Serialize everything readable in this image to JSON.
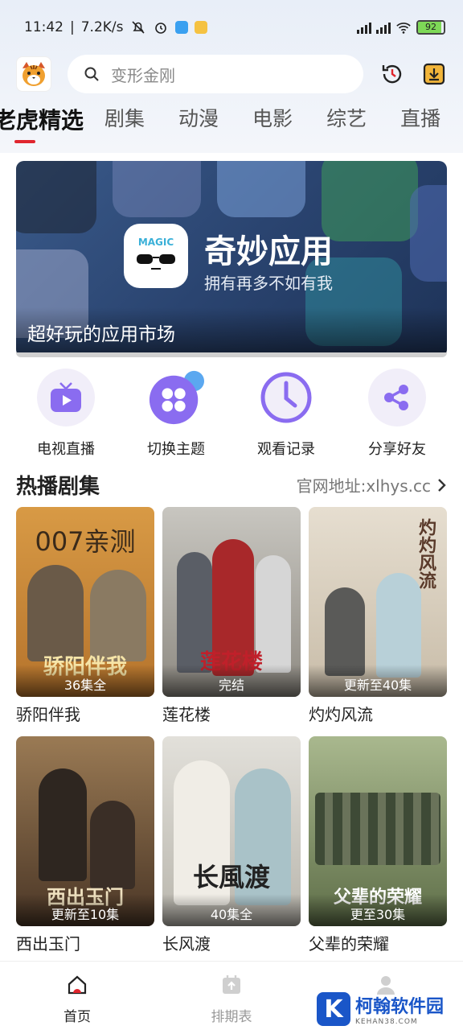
{
  "status_bar": {
    "time": "11:42",
    "speed": "7.2K/s",
    "battery": "92",
    "battery_level": 0.92
  },
  "header": {
    "search_placeholder": "变形金刚"
  },
  "tabs": [
    {
      "label": "老虎精选",
      "active": true
    },
    {
      "label": "剧集"
    },
    {
      "label": "动漫"
    },
    {
      "label": "电影"
    },
    {
      "label": "综艺"
    },
    {
      "label": "直播"
    }
  ],
  "banner": {
    "icon_text": "MAGIC",
    "title": "奇妙应用",
    "subtitle": "拥有再多不如有我",
    "caption": "超好玩的应用市场"
  },
  "quick_actions": [
    {
      "label": "电视直播",
      "icon": "tv-icon"
    },
    {
      "label": "切换主题",
      "icon": "theme-icon"
    },
    {
      "label": "观看记录",
      "icon": "clock-icon"
    },
    {
      "label": "分享好友",
      "icon": "share-icon"
    }
  ],
  "section": {
    "title": "热播剧集",
    "more": "官网地址:xlhys.cc"
  },
  "shows": [
    {
      "title": "骄阳伴我",
      "badge": "36集全",
      "poster_text": "007亲测",
      "poster_title": "骄阳伴我",
      "bg": "#c98a3a"
    },
    {
      "title": "莲花楼",
      "badge": "完结",
      "poster_title": "莲花楼",
      "bg": "#b8b4ad"
    },
    {
      "title": "灼灼风流",
      "badge": "更新至40集",
      "poster_title": "灼灼风流",
      "bg": "#d9cfbf"
    },
    {
      "title": "西出玉门",
      "badge": "更新至10集",
      "poster_title": "西出玉门",
      "bg": "#7a5a3c"
    },
    {
      "title": "长风渡",
      "badge": "40集全",
      "poster_title": "长風渡",
      "bg": "#d8d6cf"
    },
    {
      "title": "父辈的荣耀",
      "badge": "更至30集",
      "poster_title": "父辈的荣耀",
      "bg": "#6e7f5a"
    }
  ],
  "bottom_nav": [
    {
      "label": "首页",
      "active": true
    },
    {
      "label": "排期表"
    }
  ],
  "watermark": {
    "mark": "K",
    "title": "柯翰软件园",
    "sub": "KEHAN38.COM"
  }
}
